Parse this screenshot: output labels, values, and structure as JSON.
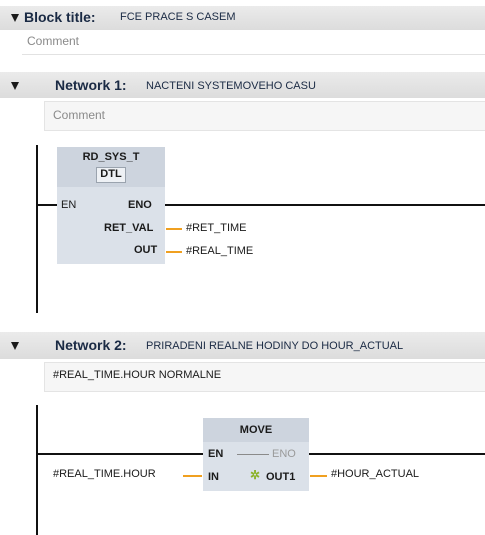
{
  "block": {
    "title_label": "Block title:",
    "title_value": "FCE PRACE S CASEM",
    "comment": "Comment"
  },
  "network1": {
    "label": "Network 1:",
    "title": "NACTENI SYSTEMOVEHO CASU",
    "comment": "Comment",
    "box": {
      "name": "RD_SYS_T",
      "type": "DTL",
      "en": "EN",
      "eno": "ENO",
      "ret_val": "RET_VAL",
      "out": "OUT"
    },
    "ret_val_operand": "#RET_TIME",
    "out_operand": "#REAL_TIME"
  },
  "network2": {
    "label": "Network 2:",
    "title": "PRIRADENI REALNE HODINY DO HOUR_ACTUAL",
    "comment": "#REAL_TIME.HOUR NORMALNE",
    "box": {
      "name": "MOVE",
      "en": "EN",
      "eno": "ENO",
      "in": "IN",
      "out1": "OUT1"
    },
    "in_operand": "#REAL_TIME.HOUR",
    "out1_operand": "#HOUR_ACTUAL"
  },
  "colors": {
    "wire": "#111111",
    "assignment": "#f0a020",
    "block_fill": "#dbe1e9",
    "header_fill": "#e2e2e2"
  }
}
